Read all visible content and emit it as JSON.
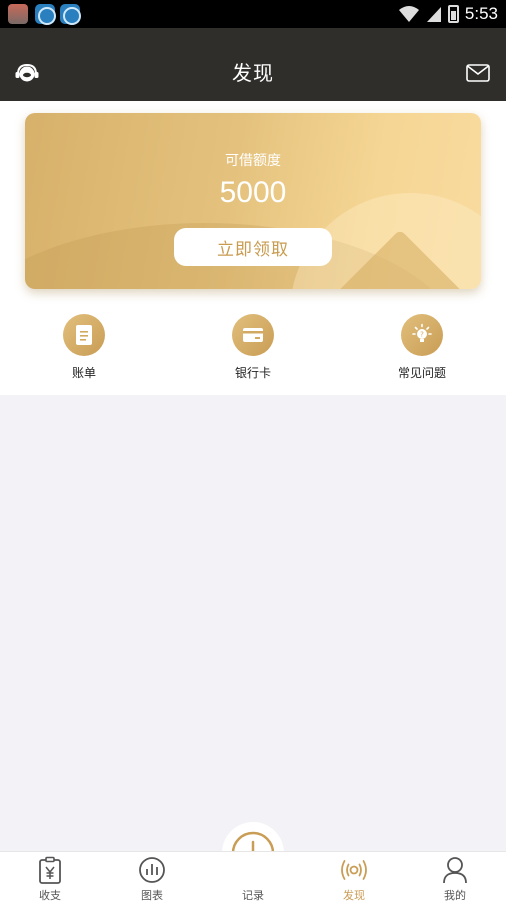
{
  "status_bar": {
    "time": "5:53"
  },
  "header": {
    "title": "发现",
    "left_icon": "headset-icon",
    "right_icon": "mail-icon"
  },
  "credit_card": {
    "label": "可借额度",
    "amount": "5000",
    "button_label": "立即领取"
  },
  "quick_menu": [
    {
      "label": "账单",
      "icon": "bill-icon"
    },
    {
      "label": "银行卡",
      "icon": "bank-card-icon"
    },
    {
      "label": "常见问题",
      "icon": "lightbulb-icon"
    }
  ],
  "bottom_nav": [
    {
      "label": "收支",
      "icon": "clipboard-yen-icon",
      "active": false
    },
    {
      "label": "图表",
      "icon": "chart-icon",
      "active": false
    },
    {
      "label": "记录",
      "icon": "plus-circle-icon",
      "active": false
    },
    {
      "label": "发现",
      "icon": "broadcast-icon",
      "active": true
    },
    {
      "label": "我的",
      "icon": "user-icon",
      "active": false
    }
  ],
  "colors": {
    "header_bg": "#2f2e2b",
    "accent": "#c99d55",
    "page_bg": "#f3f3f7"
  }
}
